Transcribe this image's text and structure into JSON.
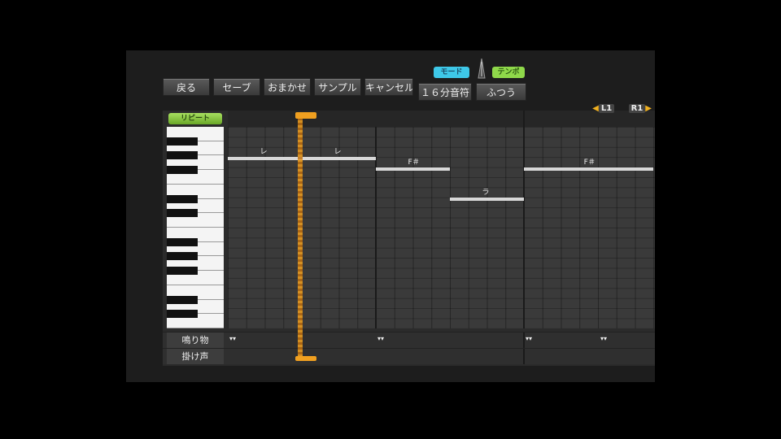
{
  "toolbar": {
    "back_label": "戻る",
    "save_label": "セーブ",
    "auto_label": "おまかせ",
    "sample_label": "サンプル",
    "cancel_label": "キャンセル",
    "mode_tag": "モード",
    "mode_value": "１６分音符",
    "tempo_tag": "テンポ",
    "tempo_value": "ふつう"
  },
  "shoulder": {
    "left": "L1",
    "right": "R1"
  },
  "roll": {
    "repeat_label": "リピート",
    "notes": [
      {
        "lyric": "レ",
        "start_step": 0,
        "length_steps": 4,
        "pitch_row": 3
      },
      {
        "lyric": "レ",
        "start_step": 4,
        "length_steps": 4,
        "pitch_row": 3
      },
      {
        "lyric": "F＃",
        "start_step": 8,
        "length_steps": 4,
        "pitch_row": 4
      },
      {
        "lyric": "ラ",
        "start_step": 12,
        "length_steps": 4,
        "pitch_row": 7
      },
      {
        "lyric": "F＃",
        "start_step": 16,
        "length_steps": 7,
        "pitch_row": 4
      }
    ]
  },
  "tracks": [
    {
      "label": "鳴り物"
    },
    {
      "label": "掛け声"
    }
  ],
  "colors": {
    "accent": "#f0a020",
    "mode_tag": "#3ec8e8",
    "tempo_tag": "#8fd84a",
    "repeat": "#8ccf44"
  }
}
